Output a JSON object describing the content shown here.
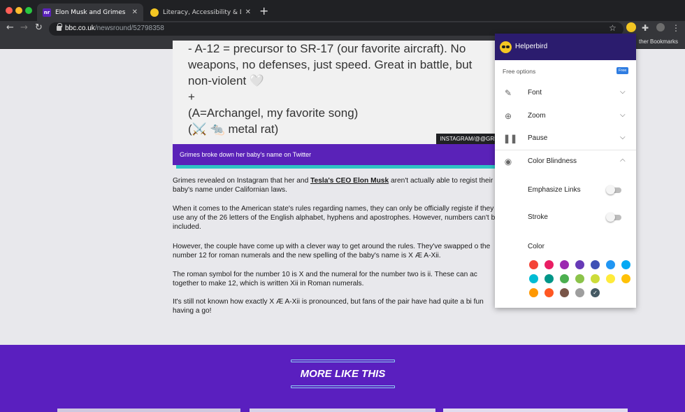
{
  "browser": {
    "tabs": [
      {
        "title": "Elon Musk and Grimes have ch",
        "favicon": "nr",
        "active": true
      },
      {
        "title": "Literacy, Accessibility & Dysle",
        "favicon": "helperbird",
        "active": false
      }
    ],
    "url_domain": "bbc.co.uk",
    "url_path": "/newsround/52798358",
    "other_bookmarks": "ther Bookmarks"
  },
  "article": {
    "image_lines": [
      "- A-12 = precursor to SR-17 (our favorite aircraft). No",
      "weapons, no defenses, just speed.  Great in battle, but",
      "non-violent 🤍",
      "+",
      "(A=Archangel, my favorite song)",
      "(⚔️ 🐀 metal rat)"
    ],
    "image_credit": "INSTAGRAM/@@GRIM",
    "caption": "Grimes broke down her baby's name on Twitter",
    "p1_before": "Grimes revealed on Instagram that her and ",
    "p1_link": "Tesla's CEO Elon Musk",
    "p1_after": " aren't actually able to regist their baby's name under Californian laws.",
    "p2": "When it comes to the American state's rules regarding names, they can only be officially registe if they use any of the 26 letters of the English alphabet, hyphens and apostrophes. However, numbers can't be included.",
    "p3": "However, the couple have come up with a clever way to get around the rules. They've swapped o the number 12 for roman numerals and the new spelling of the baby's name is X Æ A-Xii.",
    "p4": "The roman symbol for the number 10 is X and the numeral for the number two is ii. These can ac together to make 12, which is written Xii in Roman numerals.",
    "p5": "It's still not known how exactly X Æ A-Xii is pronounced, but fans of the pair have had quite a bi fun having a go!"
  },
  "more_like_this": {
    "title": "MORE LIKE THIS"
  },
  "helperbird": {
    "title": "Helperbird",
    "section_label": "Free options",
    "badge": "Free",
    "menu": [
      {
        "label": "Font",
        "icon": "pencil-icon",
        "expanded": false
      },
      {
        "label": "Zoom",
        "icon": "zoom-icon",
        "expanded": false
      },
      {
        "label": "Pause",
        "icon": "pause-icon",
        "expanded": false
      },
      {
        "label": "Color Blindness",
        "icon": "eye-icon",
        "expanded": true
      }
    ],
    "options": {
      "emphasize_links": "Emphasize Links",
      "stroke": "Stroke",
      "color": "Color"
    },
    "colors": [
      "#f44336",
      "#e91e63",
      "#9c27b0",
      "#673ab7",
      "#3f51b5",
      "#2196f3",
      "#03a9f4",
      "#00bcd4",
      "#009688",
      "#4caf50",
      "#8bc34a",
      "#cddc39",
      "#ffeb3b",
      "#ffc107",
      "#ff9800",
      "#ff5722",
      "#795548",
      "#9e9e9e",
      "#455a64"
    ],
    "selected_color": "#455a64"
  }
}
